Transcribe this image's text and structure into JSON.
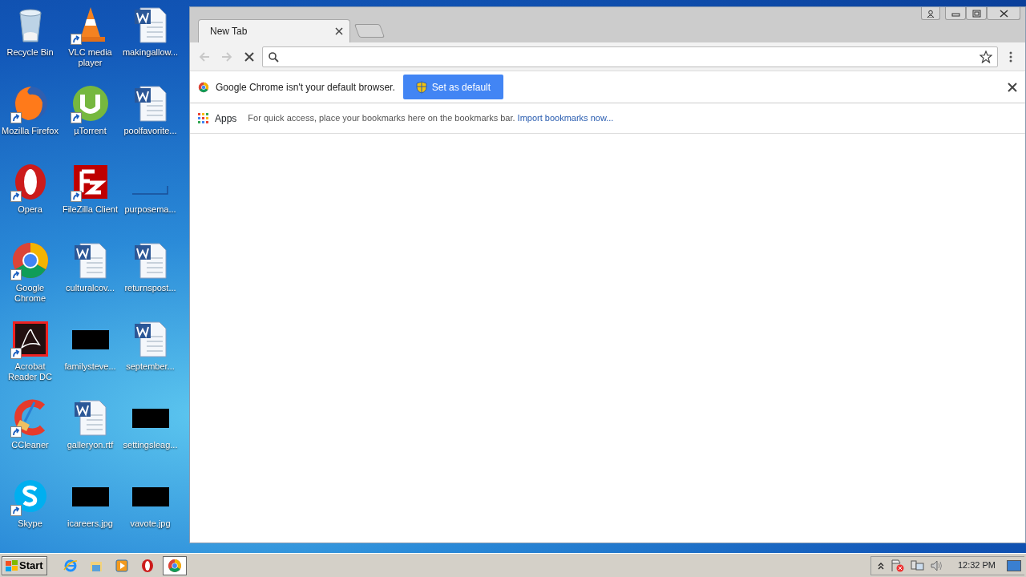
{
  "desktop": {
    "icons": [
      {
        "label": "Recycle Bin",
        "kind": "recycle",
        "shortcut": false
      },
      {
        "label": "Mozilla Firefox",
        "kind": "firefox",
        "shortcut": true
      },
      {
        "label": "Opera",
        "kind": "opera",
        "shortcut": true
      },
      {
        "label": "Google Chrome",
        "kind": "chrome",
        "shortcut": true
      },
      {
        "label": "Acrobat Reader DC",
        "kind": "acrobat",
        "shortcut": true
      },
      {
        "label": "CCleaner",
        "kind": "ccleaner",
        "shortcut": true
      },
      {
        "label": "Skype",
        "kind": "skype",
        "shortcut": true
      },
      {
        "label": "VLC media player",
        "kind": "vlc",
        "shortcut": true
      },
      {
        "label": "µTorrent",
        "kind": "utorrent",
        "shortcut": true
      },
      {
        "label": "FileZilla Client",
        "kind": "filezilla",
        "shortcut": true
      },
      {
        "label": "culturalcov...",
        "kind": "word",
        "shortcut": false
      },
      {
        "label": "familysteve...",
        "kind": "thumbnail",
        "shortcut": false
      },
      {
        "label": "galleryon.rtf",
        "kind": "word",
        "shortcut": false
      },
      {
        "label": "icareers.jpg",
        "kind": "thumbnail",
        "shortcut": false
      },
      {
        "label": "makingallow...",
        "kind": "word",
        "shortcut": false
      },
      {
        "label": "poolfavorite...",
        "kind": "word",
        "shortcut": false
      },
      {
        "label": "purposema...",
        "kind": "blank",
        "shortcut": false
      },
      {
        "label": "returnspost...",
        "kind": "word",
        "shortcut": false
      },
      {
        "label": "september...",
        "kind": "word",
        "shortcut": false
      },
      {
        "label": "settingsleag...",
        "kind": "thumbnail",
        "shortcut": false
      },
      {
        "label": "vavote.jpg",
        "kind": "thumbnail",
        "shortcut": false
      }
    ]
  },
  "browser": {
    "tabs": [
      {
        "label": "New Tab",
        "selected": true
      }
    ],
    "toolbar": {
      "back_disabled": true,
      "forward_disabled": true
    },
    "infobar": {
      "message": "Google Chrome isn't your default browser.",
      "button": "Set as default"
    },
    "bookmarks_bar": {
      "apps": "Apps",
      "hint": "For quick access, place your bookmarks here on the bookmarks bar.",
      "link": "Import bookmarks now..."
    }
  },
  "taskbar": {
    "start": "Start",
    "items": [
      {
        "kind": "ie",
        "selected": false
      },
      {
        "kind": "explorer",
        "selected": false
      },
      {
        "kind": "media",
        "selected": false
      },
      {
        "kind": "opera",
        "selected": false
      },
      {
        "kind": "chrome",
        "selected": true
      }
    ],
    "clock": "12:32 PM"
  }
}
